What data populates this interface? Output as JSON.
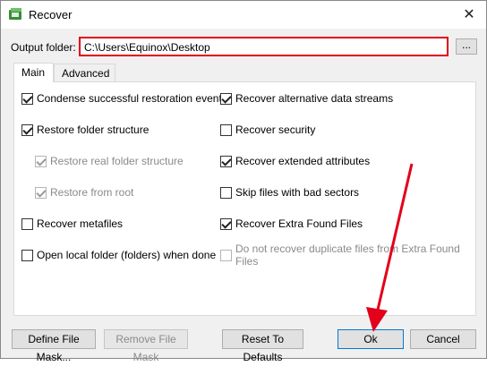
{
  "window": {
    "title": "Recover",
    "close_symbol": "✕"
  },
  "output": {
    "label": "Output folder:",
    "value": "C:\\Users\\Equinox\\Desktop",
    "browse_label": "..."
  },
  "tabs": [
    {
      "label": "Main",
      "selected": true
    },
    {
      "label": "Advanced",
      "selected": false
    }
  ],
  "options": {
    "condense": {
      "label": "Condense successful restoration events",
      "checked": true,
      "enabled": true
    },
    "restore_folder_structure": {
      "label": "Restore folder structure",
      "checked": true,
      "enabled": true
    },
    "restore_real_folder_structure": {
      "label": "Restore real folder structure",
      "checked": true,
      "enabled": false
    },
    "restore_from_root": {
      "label": "Restore from root",
      "checked": true,
      "enabled": false
    },
    "recover_metafiles": {
      "label": "Recover metafiles",
      "checked": false,
      "enabled": true
    },
    "open_local_folder": {
      "label": "Open local folder (folders) when done",
      "checked": false,
      "enabled": true
    },
    "recover_alt_streams": {
      "label": "Recover alternative data streams",
      "checked": true,
      "enabled": true
    },
    "recover_security": {
      "label": "Recover security",
      "checked": false,
      "enabled": true
    },
    "recover_ext_attributes": {
      "label": "Recover extended attributes",
      "checked": true,
      "enabled": true
    },
    "skip_bad_sectors": {
      "label": "Skip files with bad sectors",
      "checked": false,
      "enabled": true
    },
    "recover_extra_found": {
      "label": "Recover Extra Found Files",
      "checked": true,
      "enabled": true
    },
    "no_duplicate_extra": {
      "label": "Do not recover duplicate files from Extra Found Files",
      "checked": false,
      "enabled": false
    }
  },
  "buttons": {
    "define_mask": "Define File Mask...",
    "remove_mask": "Remove File Mask",
    "reset_defaults": "Reset To Defaults",
    "ok": "Ok",
    "cancel": "Cancel"
  },
  "colors": {
    "highlight": "#e2001a",
    "accent": "#0078d7"
  }
}
